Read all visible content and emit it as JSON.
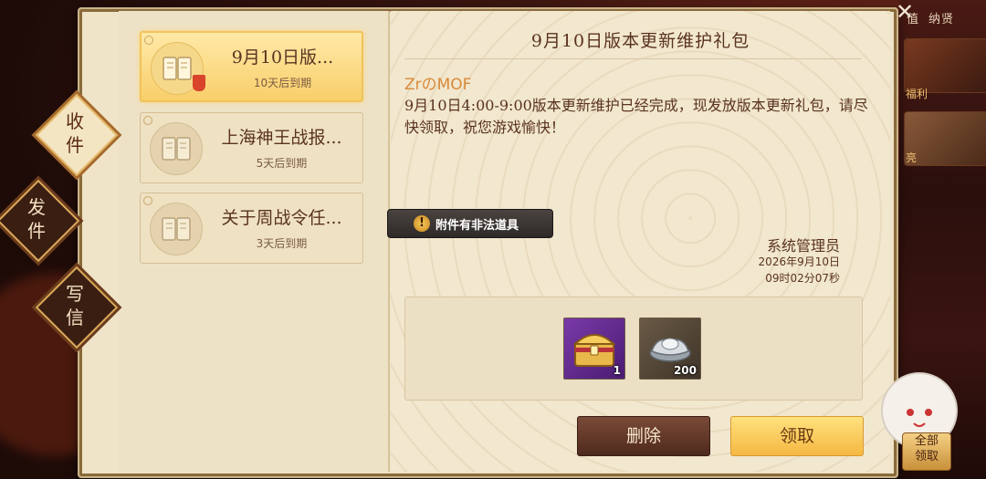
{
  "background_hud": {
    "top_labels": [
      "值",
      "纳贤"
    ],
    "side_label": "福利",
    "side_label_2": "亮"
  },
  "tabs": [
    {
      "label": "收\n件",
      "active": true
    },
    {
      "label": "发\n件",
      "active": false
    },
    {
      "label": "写\n信",
      "active": false
    }
  ],
  "mail_list": [
    {
      "title": "9月10日版...",
      "expire": "10天后到期",
      "selected": true
    },
    {
      "title": "上海神王战报...",
      "expire": "5天后到期",
      "selected": false
    },
    {
      "title": "关于周战令任...",
      "expire": "3天后到期",
      "selected": false
    }
  ],
  "message": {
    "title": "9月10日版本更新维护礼包",
    "sender": "ZrのMOF",
    "body": "9月10日4:00-9:00版本更新维护已经完成，现发放版本更新礼包，请尽快领取，祝您游戏愉快！",
    "signature": "系统管理员",
    "date": "2026年9月10日",
    "time": "09时02分07秒"
  },
  "warning": {
    "icon": "exclamation-icon",
    "text": "附件有非法道具"
  },
  "attachments": [
    {
      "icon": "treasure-chest-icon",
      "count": "1"
    },
    {
      "icon": "silver-ingot-icon",
      "count": "200"
    }
  ],
  "buttons": {
    "delete": "删除",
    "claim": "领取",
    "claim_all": "全部\n领取"
  },
  "close": "✕",
  "colors": {
    "sender": "#d88a3a",
    "text": "#5a3320",
    "claim_button": "#f5b842",
    "delete_button": "#5e3426"
  }
}
